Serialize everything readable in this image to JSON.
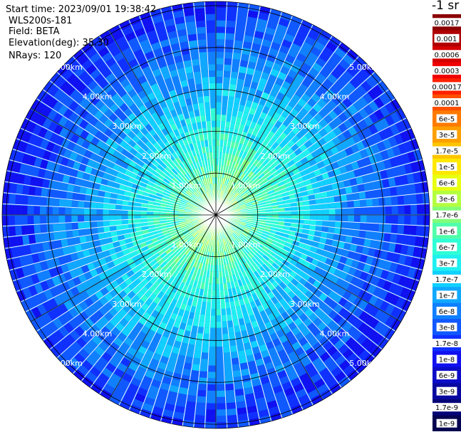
{
  "header": {
    "start_time": "Start time: 2023/09/01 19:38:42",
    "instrument": "WLS200s-181",
    "field": "Field: BETA",
    "elevation": "Elevation(deg): 35.30",
    "nrays": "NRays: 120"
  },
  "units_label": "-1 sr",
  "chart_data": {
    "type": "heatmap",
    "projection": "polar",
    "field": "BETA",
    "elevation_deg": 35.3,
    "n_rays": 120,
    "range_rings_km": [
      1,
      2,
      3,
      4,
      5
    ],
    "ring_labels": [
      "1.00km",
      "2.00km",
      "3.00km",
      "4.00km",
      "5.00km"
    ],
    "spoke_step_deg": 30,
    "colorbar": {
      "label": "-1 sr",
      "ticks": [
        "0.0017",
        "0.001",
        "0.0006",
        "0.0003",
        "0.00017",
        "0.0001",
        "6e-5",
        "3e-5",
        "1.7e-5",
        "1e-5",
        "6e-6",
        "3e-6",
        "1.7e-6",
        "1e-6",
        "6e-7",
        "3e-7",
        "1.7e-7",
        "1e-7",
        "6e-8",
        "3e-8",
        "1.7e-8",
        "1e-8",
        "6e-9",
        "3e-9",
        "1.7e-9",
        "1e-9"
      ],
      "colors": [
        "#8b0000",
        "#b00000",
        "#d40000",
        "#f00000",
        "#ff2000",
        "#ff5000",
        "#ff7a00",
        "#ffa000",
        "#ffc400",
        "#ffe800",
        "#e8ff10",
        "#b4ff40",
        "#80ff78",
        "#50ffaa",
        "#30ffd6",
        "#20f0f0",
        "#10d0ff",
        "#10a8ff",
        "#1080ff",
        "#1058ff",
        "#1030ff",
        "#1010f0",
        "#0c0cc8",
        "#0808a0",
        "#040478",
        "#020250"
      ]
    }
  }
}
